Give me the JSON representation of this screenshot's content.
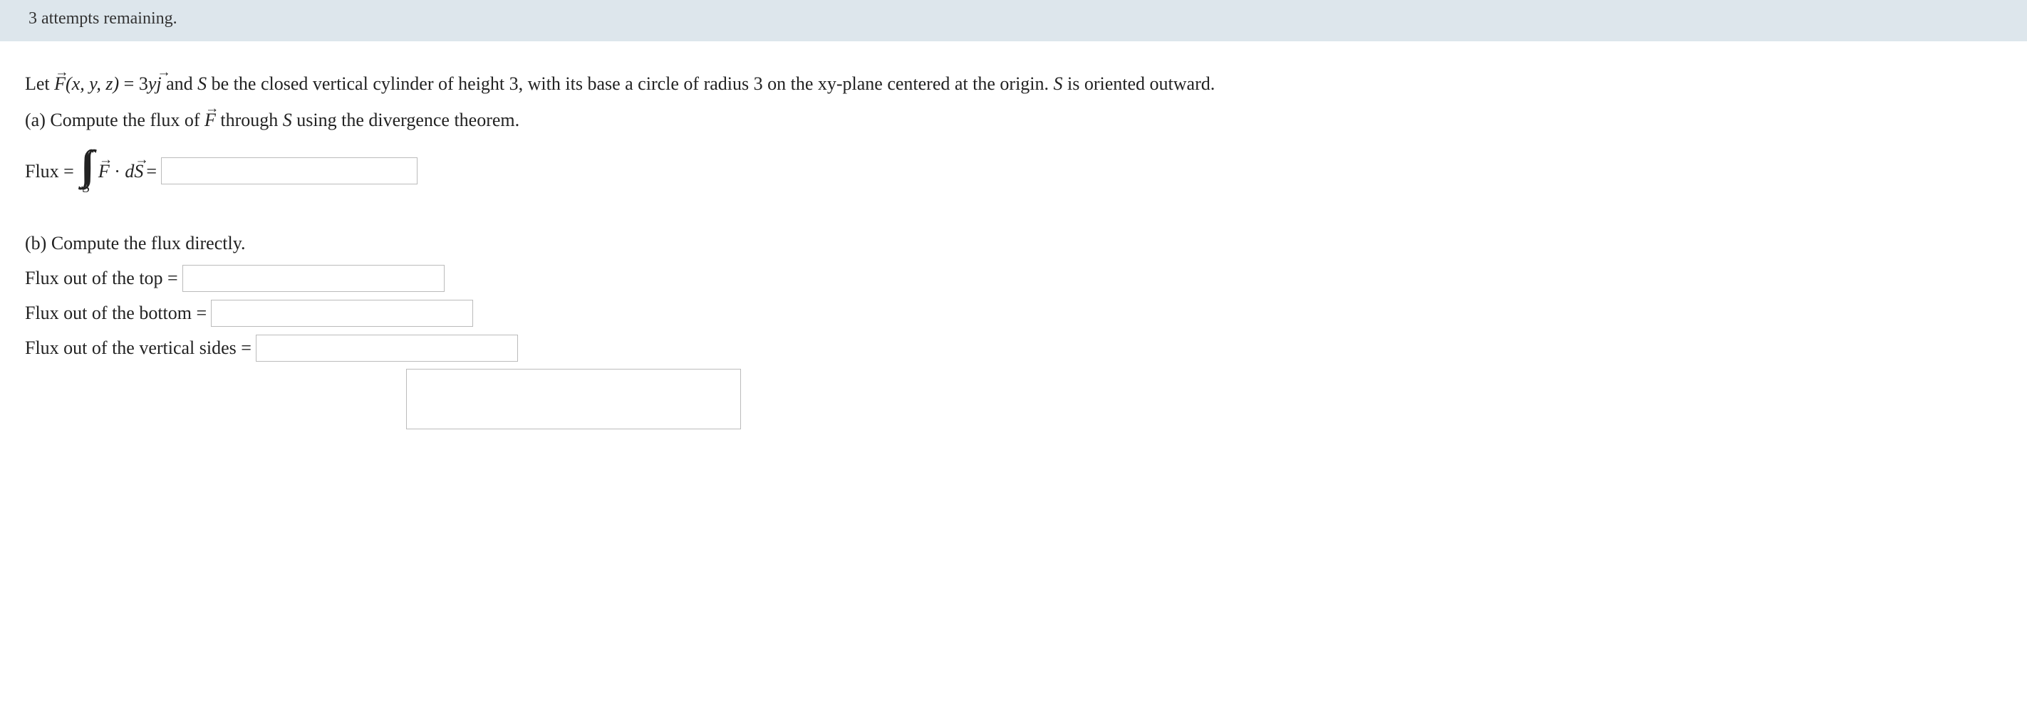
{
  "banner": {
    "text": "3 attempts remaining."
  },
  "problem": {
    "intro_prefix": "Let ",
    "f_expr_lhs": "F(x, y, z)",
    "f_expr_eq": " = ",
    "f_coeff": "3",
    "f_var": "y",
    "f_unit": "j",
    "intro_middle": " and ",
    "s_var": "S",
    "intro_rest1": " be the closed vertical cylinder of height ",
    "height": "3",
    "intro_rest2": ", with its base a circle of radius ",
    "radius": "3",
    "intro_rest3": " on the xy-plane centered at the origin. ",
    "intro_rest4": " is oriented outward."
  },
  "part_a": {
    "label": "(a) Compute the flux of ",
    "after_f": " through ",
    "after_s": " using the divergence theorem.",
    "flux_label": "Flux = ",
    "integrand_f": "F",
    "dot": " · ",
    "d": "d",
    "s_vec": "S",
    "after_integral": " = ",
    "sub": "S"
  },
  "part_b": {
    "heading": "(b) Compute the flux directly.",
    "top_label": "Flux out of the top = ",
    "bottom_label": "Flux out of the bottom = ",
    "sides_label": "Flux out of the vertical sides = "
  }
}
